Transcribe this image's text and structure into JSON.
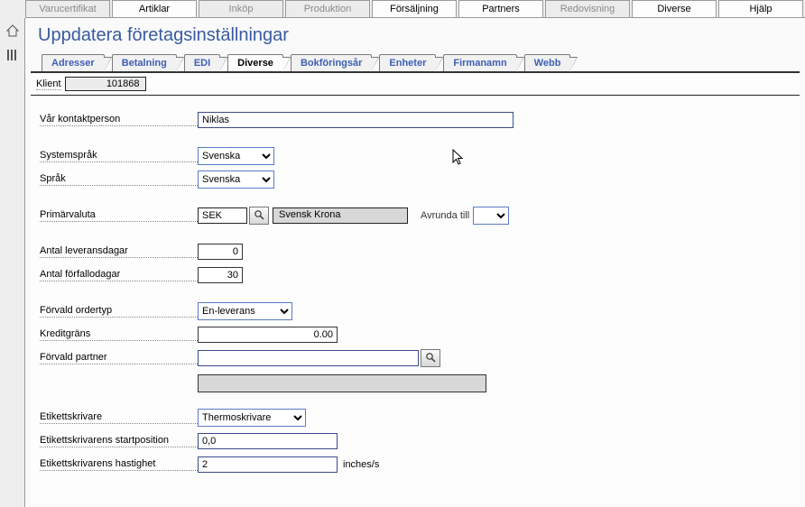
{
  "menu": {
    "items": [
      {
        "label": "Varucertifikat",
        "active": false
      },
      {
        "label": "Artiklar",
        "active": true
      },
      {
        "label": "Inköp",
        "active": false
      },
      {
        "label": "Produktion",
        "active": false
      },
      {
        "label": "Försäljning",
        "active": true
      },
      {
        "label": "Partners",
        "active": true
      },
      {
        "label": "Redovisning",
        "active": false
      },
      {
        "label": "Diverse",
        "active": true
      },
      {
        "label": "Hjälp",
        "active": true
      }
    ]
  },
  "page": {
    "title": "Uppdatera företagsinställningar"
  },
  "tabs": [
    {
      "label": "Adresser",
      "active": false
    },
    {
      "label": "Betalning",
      "active": false
    },
    {
      "label": "EDI",
      "active": false
    },
    {
      "label": "Diverse",
      "active": true
    },
    {
      "label": "Bokföringsår",
      "active": false
    },
    {
      "label": "Enheter",
      "active": false
    },
    {
      "label": "Firmanamn",
      "active": false
    },
    {
      "label": "Webb",
      "active": false
    }
  ],
  "klient": {
    "label": "Klient",
    "value": "101868"
  },
  "form": {
    "contact": {
      "label": "Vår kontaktperson",
      "value": "Niklas"
    },
    "syslang": {
      "label": "Systemspråk",
      "value": "Svenska"
    },
    "lang": {
      "label": "Språk",
      "value": "Svenska"
    },
    "pcur": {
      "label": "Primärvaluta",
      "code": "SEK",
      "name": "Svensk Krona"
    },
    "round": {
      "label": "Avrunda till",
      "value": ""
    },
    "deliverydays": {
      "label": "Antal leveransdagar",
      "value": "0"
    },
    "duedays": {
      "label": "Antal förfallodagar",
      "value": "30"
    },
    "ordertype": {
      "label": "Förvald ordertyp",
      "value": "En-leverans"
    },
    "creditlimit": {
      "label": "Kreditgräns",
      "value": "0.00"
    },
    "defpartner": {
      "label": "Förvald partner",
      "value": ""
    },
    "labelprinter": {
      "label": "Etikettskrivare",
      "value": "Thermoskrivare"
    },
    "labelstart": {
      "label": "Etikettskrivarens startposition",
      "value": "0,0"
    },
    "labelspeed": {
      "label": "Etikettskrivarens hastighet",
      "value": "2",
      "unit": "inches/s"
    }
  }
}
